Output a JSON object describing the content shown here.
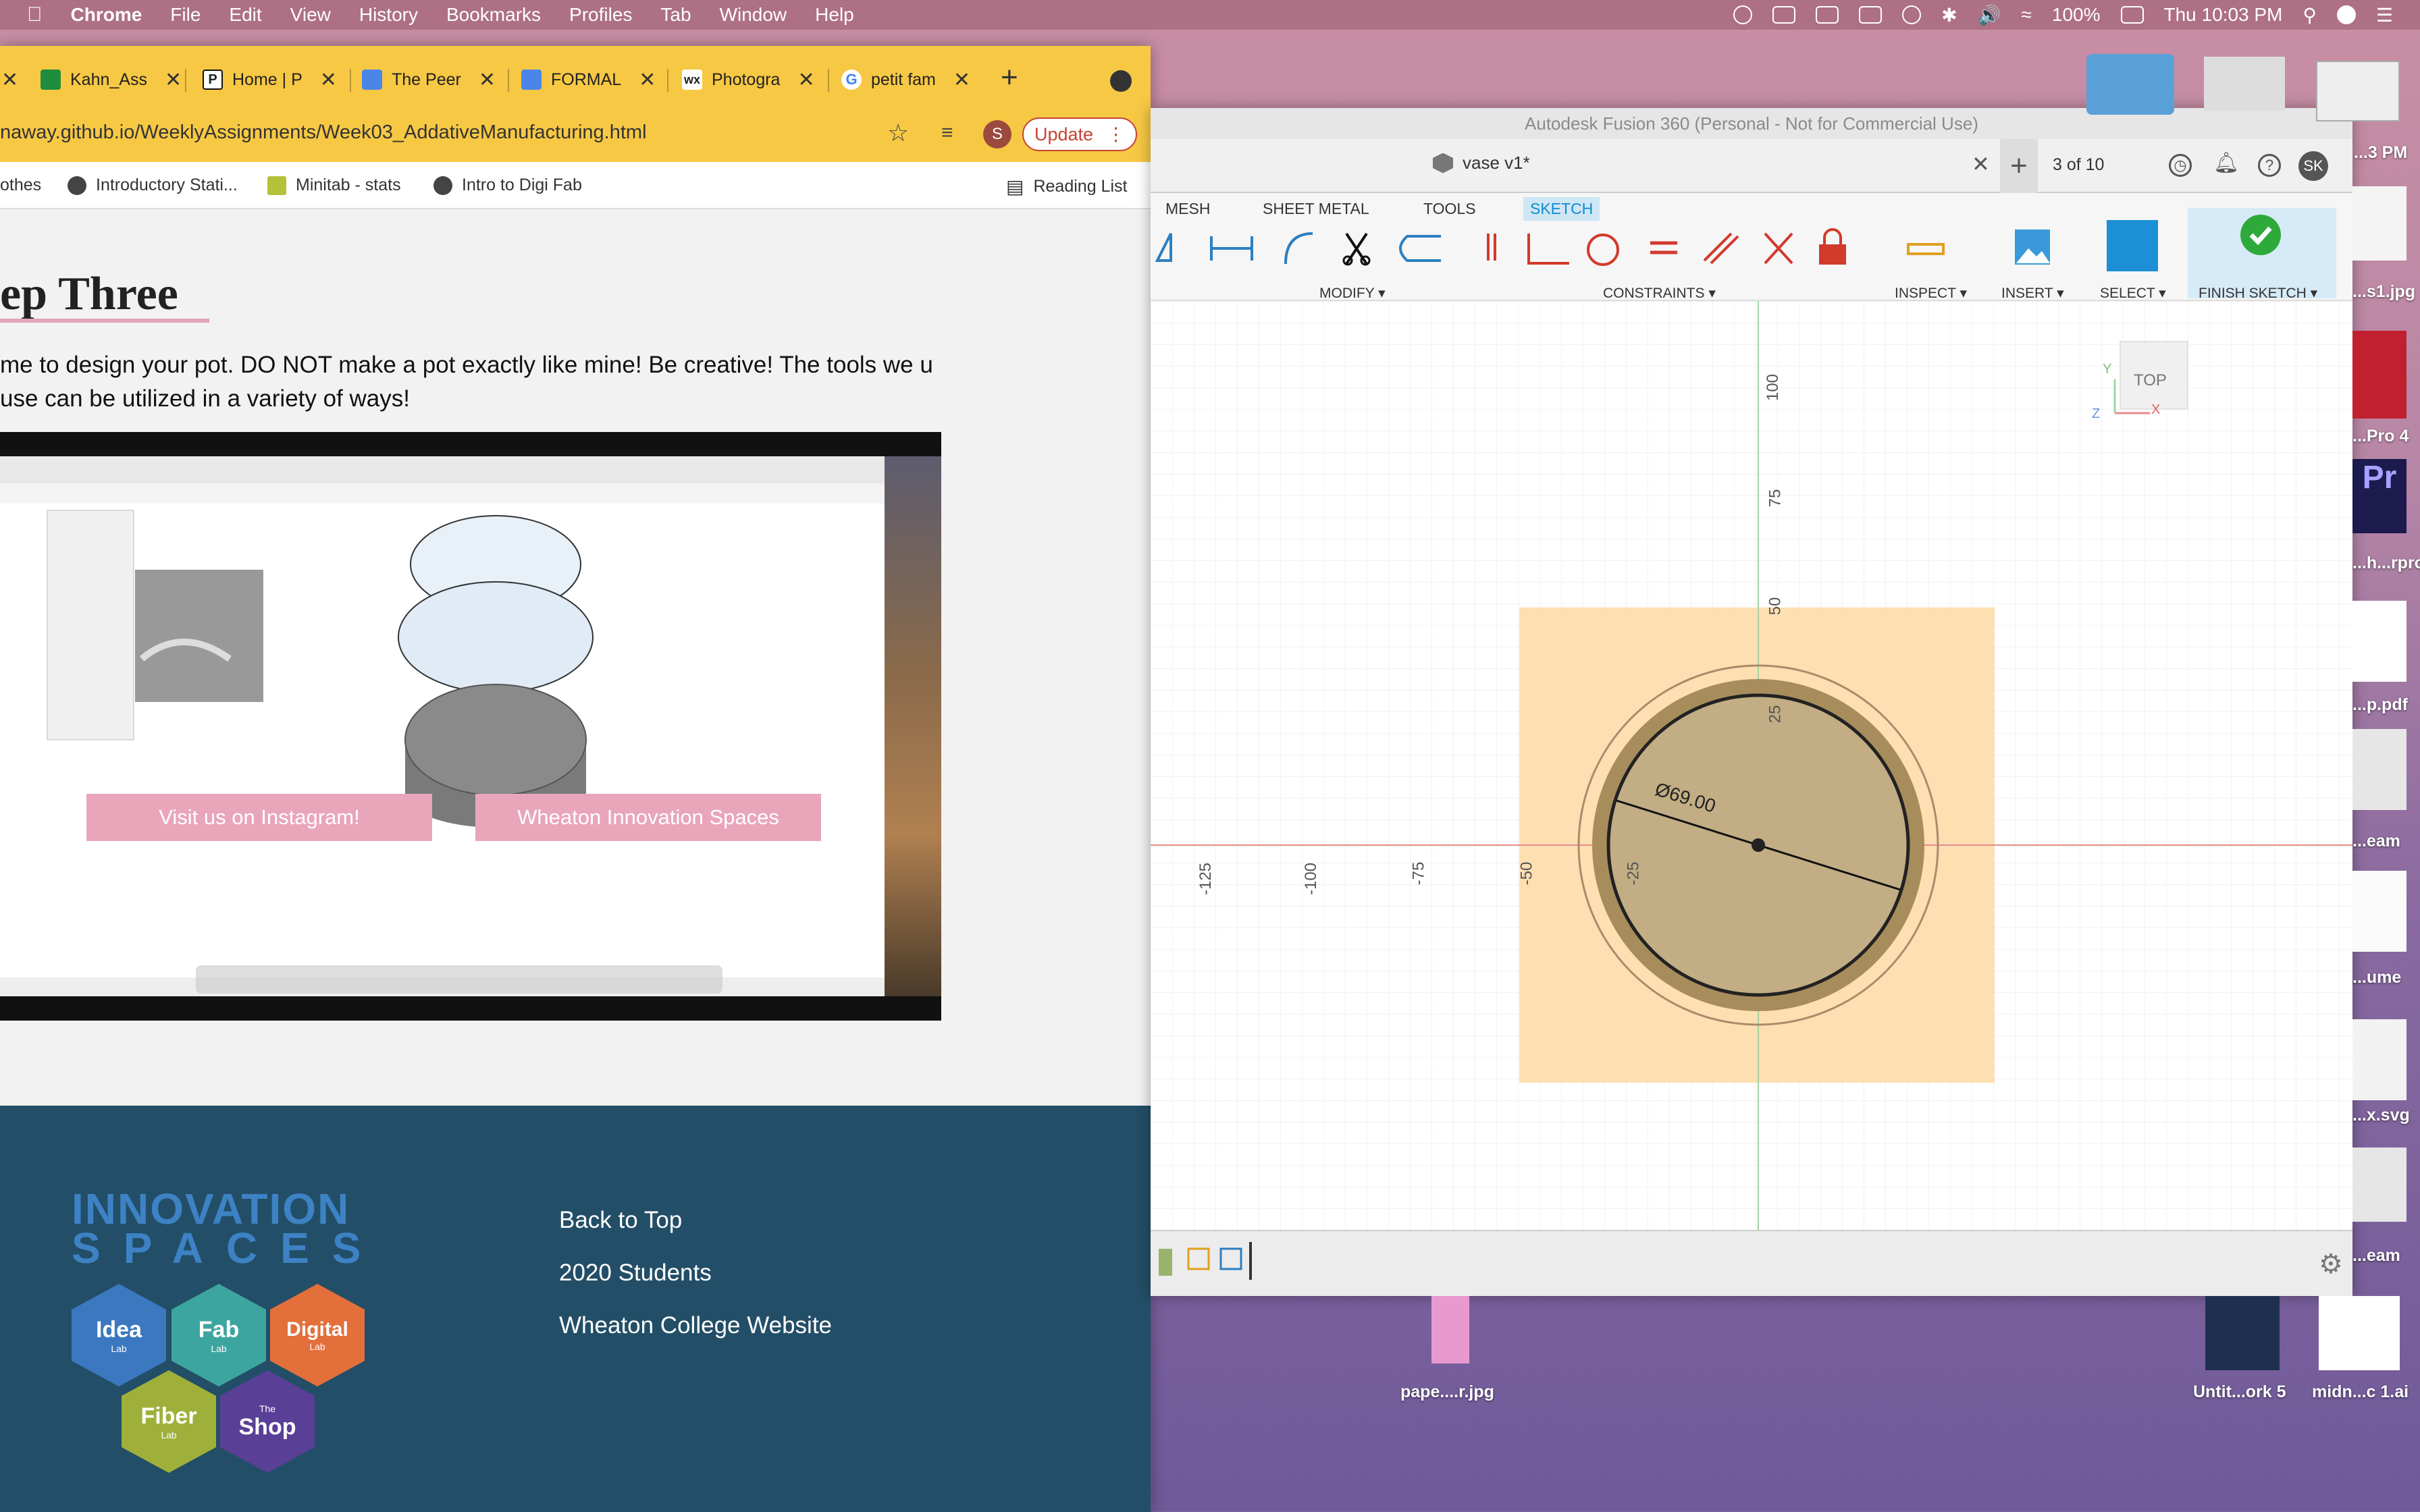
{
  "menubar": {
    "app_name": "Chrome",
    "menus": [
      "File",
      "Edit",
      "View",
      "History",
      "Bookmarks",
      "Profiles",
      "Tab",
      "Window",
      "Help"
    ],
    "battery": "100%",
    "clock": "Thu 10:03 PM"
  },
  "chrome": {
    "tabs": [
      {
        "label": "Kahn_Ass",
        "color": "#1e8e3e"
      },
      {
        "label": "Home | P",
        "color": "#111111"
      },
      {
        "label": "The Peer",
        "color": "#4a86e8"
      },
      {
        "label": "FORMAL",
        "color": "#4a86e8"
      },
      {
        "label": "Photogra",
        "color": "#222222"
      },
      {
        "label": "petit fam",
        "color": "#4285f4"
      }
    ],
    "url": "naway.github.io/WeeklyAssignments/Week03_AddativeManufacturing.html",
    "profile_initial": "S",
    "update_label": "Update",
    "bookmarks": [
      "othes",
      "Introductory Stati...",
      "Minitab - stats",
      "Intro to Digi Fab"
    ],
    "reading_list": "Reading List"
  },
  "page": {
    "title": "ep Three",
    "instructions": "me to design your pot. DO NOT make a pot exactly like mine! Be creative! The tools we u use can be utilized in a variety of ways!"
  },
  "footer": {
    "logo_line1": "INNOVATION",
    "logo_line2": "SPACES",
    "hexes": [
      {
        "label": "Idea",
        "sub": "Lab",
        "color": "#3b78c0"
      },
      {
        "label": "Fab",
        "sub": "Lab",
        "color": "#3da5a0"
      },
      {
        "label": "Digital",
        "sub": "Lab",
        "color": "#e36f3a"
      },
      {
        "label": "Fiber",
        "sub": "Lab",
        "color": "#9fb03a"
      },
      {
        "label": "Shop",
        "sub": "The",
        "color": "#5a3f96"
      }
    ],
    "links": [
      "Back to Top",
      "2020 Students",
      "Wheaton College Website"
    ],
    "buttons": [
      "Visit us on Instagram!",
      "Wheaton Innovation Spaces"
    ]
  },
  "fusion": {
    "window_title": "Autodesk Fusion 360 (Personal - Not for Commercial Use)",
    "doc_title": "vase v1*",
    "version": "3 of 10",
    "user_initials": "SK",
    "tabs": [
      "MESH",
      "SHEET METAL",
      "TOOLS",
      "SKETCH"
    ],
    "groups": [
      "MODIFY ▾",
      "CONSTRAINTS ▾",
      "INSPECT ▾",
      "INSERT ▾",
      "SELECT ▾",
      "FINISH SKETCH ▾"
    ],
    "viewcube": "TOP",
    "dimension": "Ø69.00",
    "ruler_x": [
      "-125",
      "-100",
      "-75",
      "-50",
      "-25"
    ],
    "ruler_y": [
      "100",
      "75",
      "50",
      "25"
    ],
    "axis_labels": {
      "x": "X",
      "y": "Y",
      "z": "Z"
    }
  },
  "desktop": {
    "labels": [
      "...3 PM",
      "...s1.jpg",
      "...Pro 4",
      "...h...rpro",
      "...p.pdf",
      "...eam",
      "...ume",
      "...x.svg",
      "...eam",
      "pape....r.jpg",
      "Untit...ork 5",
      "midn...c 1.ai"
    ]
  }
}
